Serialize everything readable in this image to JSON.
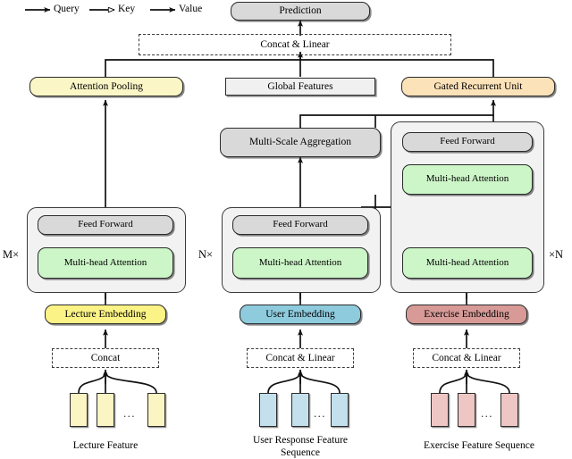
{
  "legend": {
    "items": [
      {
        "label": "Query",
        "arrow": "filled-arrow-icon"
      },
      {
        "label": "Key",
        "arrow": "hollow-arrow-icon"
      },
      {
        "label": "Value",
        "arrow": "filled-arrow-icon"
      }
    ]
  },
  "nodes": {
    "prediction": "Prediction",
    "concat_linear_top": "Concat & Linear",
    "attention_pooling": "Attention Pooling",
    "global_features": "Global Features",
    "gated_recurrent_unit": "Gated Recurrent Unit",
    "multi_scale_aggregation": "Multi-Scale Aggregation",
    "feed_forward": "Feed Forward",
    "multi_head_attention": "Multi-head Attention",
    "lecture_embedding": "Lecture Embedding",
    "user_embedding": "User Embedding",
    "exercise_embedding": "Exercise Embedding",
    "concat_left": "Concat",
    "concat_linear_mid": "Concat & Linear",
    "concat_linear_right": "Concat & Linear"
  },
  "repeat_labels": {
    "left": "M×",
    "middle": "N×",
    "right": "×N"
  },
  "captions": {
    "lecture": "Lecture Feature",
    "user_line1": "User Response Feature",
    "user_line2": "Sequence",
    "exercise": "Exercise Feature Sequence"
  },
  "ellipsis": "...",
  "colors": {
    "prediction": "#d9d9d9",
    "global_features": "#f0f0f0",
    "attention_pooling": "#fbf6c6",
    "gated_recurrent_unit": "#fbe2b9",
    "multi_scale_aggregation": "#d9d9d9",
    "feed_forward": "#d9d9d9",
    "multi_head_attention": "#ccf5c8",
    "lecture_embedding": "#fbf385",
    "user_embedding": "#8ecbdd",
    "exercise_embedding": "#d79a97",
    "lecture_bar": "#fbf4c3",
    "user_bar": "#c3e0ec",
    "exercise_bar": "#eec6c4",
    "group_panel": "#f2f2f2",
    "stroke": "#2b2b2b"
  }
}
